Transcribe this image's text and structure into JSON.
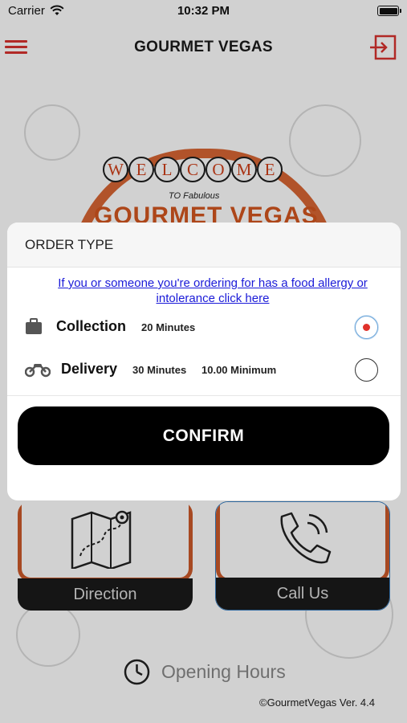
{
  "status_bar": {
    "carrier": "Carrier",
    "time": "10:32 PM"
  },
  "nav": {
    "title": "GOURMET VEGAS"
  },
  "background": {
    "welcome_letters": [
      "W",
      "E",
      "L",
      "C",
      "O",
      "M",
      "E"
    ],
    "fabulous": "TO Fabulous",
    "sign_text": "GOURMET VEGAS",
    "tiles": [
      {
        "label": "Direction",
        "icon": "map-icon"
      },
      {
        "label": "Call Us",
        "icon": "phone-icon"
      }
    ],
    "opening_hours": "Opening Hours",
    "copyright": "©GourmetVegas Ver. 4.4"
  },
  "modal": {
    "title": "ORDER TYPE",
    "allergy_link": "If you or someone you're ordering for has a food allergy or intolerance click here",
    "options": [
      {
        "name": "Collection",
        "time": "20 Minutes",
        "minimum": "",
        "selected": true,
        "icon": "briefcase-icon"
      },
      {
        "name": "Delivery",
        "time": "30 Minutes",
        "minimum": "10.00 Minimum",
        "selected": false,
        "icon": "motorbike-icon"
      }
    ],
    "confirm_label": "CONFIRM"
  },
  "colors": {
    "accent": "#d8322f",
    "brand_orange": "#d4561f",
    "radio_selected": "#e0312a",
    "link": "#1a1ad8"
  }
}
